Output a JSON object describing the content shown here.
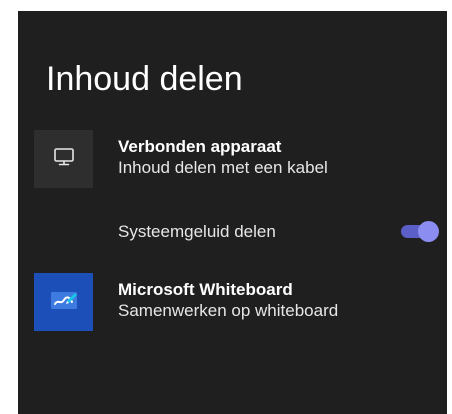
{
  "page": {
    "title": "Inhoud delen"
  },
  "items": [
    {
      "title": "Verbonden apparaat",
      "subtitle": "Inhoud delen met een kabel",
      "icon": "monitor-icon"
    },
    {
      "title": "Microsoft Whiteboard",
      "subtitle": "Samenwerken op whiteboard",
      "icon": "whiteboard-icon"
    }
  ],
  "system_sound": {
    "label": "Systeemgeluid delen",
    "enabled": true
  },
  "colors": {
    "panel_background": "#1f1f1f",
    "toggle_track": "#5b5fc7",
    "toggle_thumb": "#8b8ef0",
    "whiteboard_tile": "#1d4fb8"
  }
}
